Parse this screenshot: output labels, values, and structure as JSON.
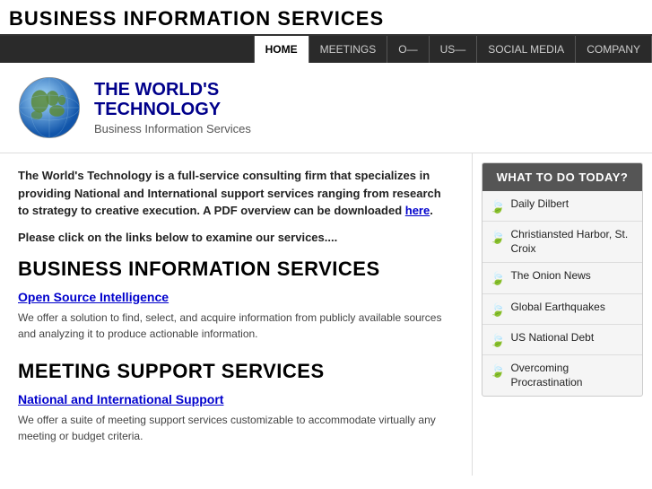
{
  "header": {
    "page_title": "BUSINESS INFORMATION SERVICES"
  },
  "nav": {
    "items": [
      {
        "label": "HOME",
        "active": true
      },
      {
        "label": "MEETINGS",
        "active": false
      },
      {
        "label": "O—",
        "active": false
      },
      {
        "label": "US—",
        "active": false
      },
      {
        "label": "SOCIAL MEDIA",
        "active": false
      },
      {
        "label": "COMPANY",
        "active": false
      }
    ]
  },
  "logo": {
    "main_title_line1": "THE WORLD'S",
    "main_title_line2": "TECHNOLOGY",
    "sub_title": "Business Information Services"
  },
  "intro": {
    "text": "The World's Technology is a full-service consulting firm that specializes in providing National and International support services ranging from research to strategy to creative execution. A PDF overview can be downloaded ",
    "link_text": "here",
    "text_end": ".",
    "prompt": "Please click on the links below to examine our services...."
  },
  "sections": [
    {
      "heading": "BUSINESS INFORMATION SERVICES",
      "service_name": "Open Source Intelligence",
      "service_desc": "We offer a solution to find, select, and acquire information from publicly available sources and analyzing it to produce actionable information."
    },
    {
      "heading": "MEETING SUPPORT SERVICES",
      "service_name": "National and International Support",
      "service_desc": "We offer a suite of meeting support services customizable to accommodate virtually any meeting or budget criteria."
    }
  ],
  "sidebar": {
    "header": "WHAT TO DO TODAY?",
    "items": [
      {
        "label": "Daily Dilbert"
      },
      {
        "label": "Christiansted Harbor, St. Croix"
      },
      {
        "label": "The Onion News"
      },
      {
        "label": "Global Earthquakes"
      },
      {
        "label": "US National Debt"
      },
      {
        "label": "Overcoming Procrastination"
      }
    ]
  }
}
